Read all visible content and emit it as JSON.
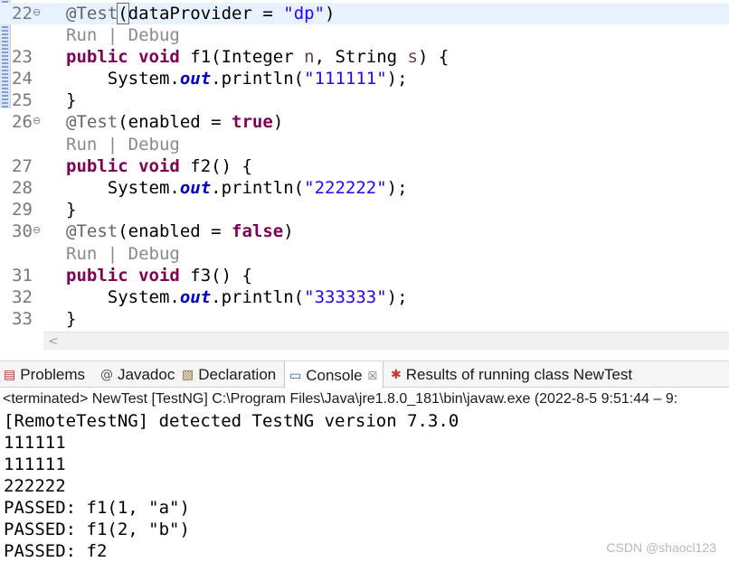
{
  "editor": {
    "lines": [
      {
        "num": "22",
        "fold": "⊖",
        "current": true,
        "kind": "ann",
        "annotation": "@Test",
        "open": "(",
        "args_key": "dataProvider",
        "eq": " = ",
        "val": "\"dp\"",
        "close": ")"
      },
      {
        "codelens": {
          "run": "Run",
          "sep": " | ",
          "debug": "Debug"
        }
      },
      {
        "num": "23",
        "kind": "sig",
        "mod1": "public",
        "mod2": "void",
        "name": " f1(Integer ",
        "p1": "n",
        "mid": ", String ",
        "p2": "s",
        "end": ") {"
      },
      {
        "num": "24",
        "kind": "println",
        "pre": "    System.",
        "field": "out",
        "call": ".println(",
        "str": "\"111111\"",
        "tail": ");"
      },
      {
        "num": "25",
        "kind": "plain",
        "text": "}"
      },
      {
        "num": "26",
        "fold": "⊖",
        "kind": "ann2",
        "annotation": "@Test",
        "args": "(enabled = ",
        "val": "true",
        "close": ")"
      },
      {
        "codelens": {
          "run": "Run",
          "sep": " | ",
          "debug": "Debug"
        }
      },
      {
        "num": "27",
        "kind": "sig2",
        "mod1": "public",
        "mod2": "void",
        "name": " f2() {"
      },
      {
        "num": "28",
        "kind": "println",
        "pre": "    System.",
        "field": "out",
        "call": ".println(",
        "str": "\"222222\"",
        "tail": ");"
      },
      {
        "num": "29",
        "kind": "plain",
        "text": "}"
      },
      {
        "num": "30",
        "fold": "⊖",
        "kind": "ann2",
        "annotation": "@Test",
        "args": "(enabled = ",
        "val": "false",
        "close": ")"
      },
      {
        "codelens": {
          "run": "Run",
          "sep": " | ",
          "debug": "Debug"
        }
      },
      {
        "num": "31",
        "kind": "sig2",
        "mod1": "public",
        "mod2": "void",
        "name": " f3() {"
      },
      {
        "num": "32",
        "kind": "println",
        "pre": "    System.",
        "field": "out",
        "call": ".println(",
        "str": "\"333333\"",
        "tail": ");"
      },
      {
        "num": "33",
        "kind": "plain",
        "text": "}"
      }
    ],
    "scroll_left_glyph": "<"
  },
  "panel": {
    "tabs": [
      {
        "label": "Problems",
        "icon": "problems-icon",
        "glyph": "▤"
      },
      {
        "label": "Javadoc",
        "icon": "javadoc-icon",
        "glyph": "@"
      },
      {
        "label": "Declaration",
        "icon": "declaration-icon",
        "glyph": "▧"
      },
      {
        "label": "Console",
        "icon": "console-icon",
        "glyph": "▭",
        "active": true,
        "close": "☒"
      },
      {
        "label": "Results of running class NewTest",
        "icon": "testng-icon",
        "glyph": "✱"
      }
    ],
    "status": "<terminated> NewTest [TestNG] C:\\Program Files\\Java\\jre1.8.0_181\\bin\\javaw.exe  (2022-8-5 9:51:44 – 9:",
    "output": [
      "[RemoteTestNG] detected TestNG version 7.3.0",
      "111111",
      "111111",
      "222222",
      "PASSED: f1(1, \"a\")",
      "PASSED: f1(2, \"b\")",
      "PASSED: f2"
    ]
  },
  "watermark": "CSDN @shaocl123",
  "colors": {
    "keyword": "#7f0055",
    "string": "#2a00ff",
    "annotation": "#646464",
    "field": "#0000c0",
    "current_line": "#e8f2fe"
  }
}
